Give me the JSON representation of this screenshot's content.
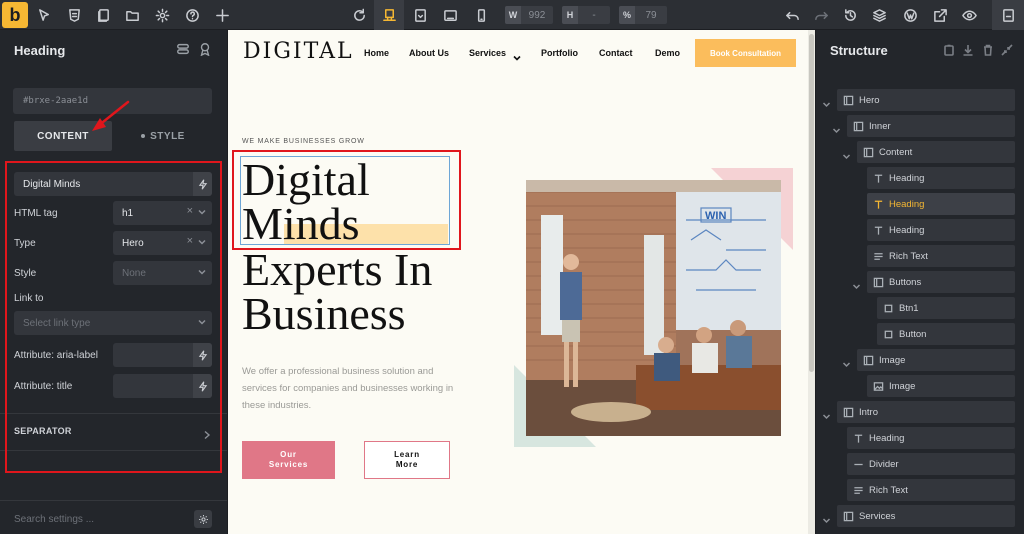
{
  "toolbar": {
    "logo": "b",
    "width_label": "W",
    "width_value": "992",
    "height_label": "H",
    "height_value": "-",
    "zoom_label": "%",
    "zoom_value": "79"
  },
  "left_panel": {
    "title": "Heading",
    "element_id": "#brxe-2aae1d",
    "tab_content": "CONTENT",
    "tab_style": "STYLE",
    "text_value": "Digital Minds",
    "html_tag_label": "HTML tag",
    "html_tag_value": "h1",
    "type_label": "Type",
    "type_value": "Hero",
    "style_label": "Style",
    "style_placeholder": "None",
    "link_label": "Link to",
    "link_placeholder": "Select link type",
    "aria_label": "Attribute: aria-label",
    "title_attr_label": "Attribute: title",
    "separator_label": "SEPARATOR",
    "search_placeholder": "Search settings ..."
  },
  "site": {
    "logo": "DIGITAL",
    "nav": [
      "Home",
      "About Us",
      "Services",
      "Portfolio",
      "Contact",
      "Demo"
    ],
    "cta": "Book Consultation",
    "tagline": "WE MAKE BUSINESSES GROW",
    "hero_lines": [
      "Digital",
      "Minds",
      "Experts In",
      "Business"
    ],
    "description": "We offer a professional business solution and services for companies and businesses working in these industries.",
    "btn_primary_line1": "Our",
    "btn_primary_line2": "Services",
    "btn_secondary_line1": "Learn",
    "btn_secondary_line2": "More",
    "image_sign": "WIN"
  },
  "structure": {
    "title": "Structure",
    "items": [
      {
        "label": "Hero",
        "icon": "section-icon"
      },
      {
        "label": "Inner",
        "icon": "container-icon"
      },
      {
        "label": "Content",
        "icon": "container-icon"
      },
      {
        "label": "Heading",
        "icon": "text-icon"
      },
      {
        "label": "Heading",
        "icon": "text-icon"
      },
      {
        "label": "Heading",
        "icon": "text-icon"
      },
      {
        "label": "Rich Text",
        "icon": "rich-text-icon"
      },
      {
        "label": "Buttons",
        "icon": "container-icon"
      },
      {
        "label": "Btn1",
        "icon": "button-icon"
      },
      {
        "label": "Button",
        "icon": "button-icon"
      },
      {
        "label": "Image",
        "icon": "container-icon"
      },
      {
        "label": "Image",
        "icon": "image-icon"
      },
      {
        "label": "Intro",
        "icon": "section-icon"
      },
      {
        "label": "Heading",
        "icon": "text-icon"
      },
      {
        "label": "Divider",
        "icon": "divider-icon"
      },
      {
        "label": "Rich Text",
        "icon": "rich-text-icon"
      },
      {
        "label": "Services",
        "icon": "section-icon"
      }
    ]
  },
  "colors": {
    "accent": "#f5b733",
    "highlight_red": "#e0161c",
    "pink": "#e07787",
    "cta_orange": "#fbbd5c"
  }
}
